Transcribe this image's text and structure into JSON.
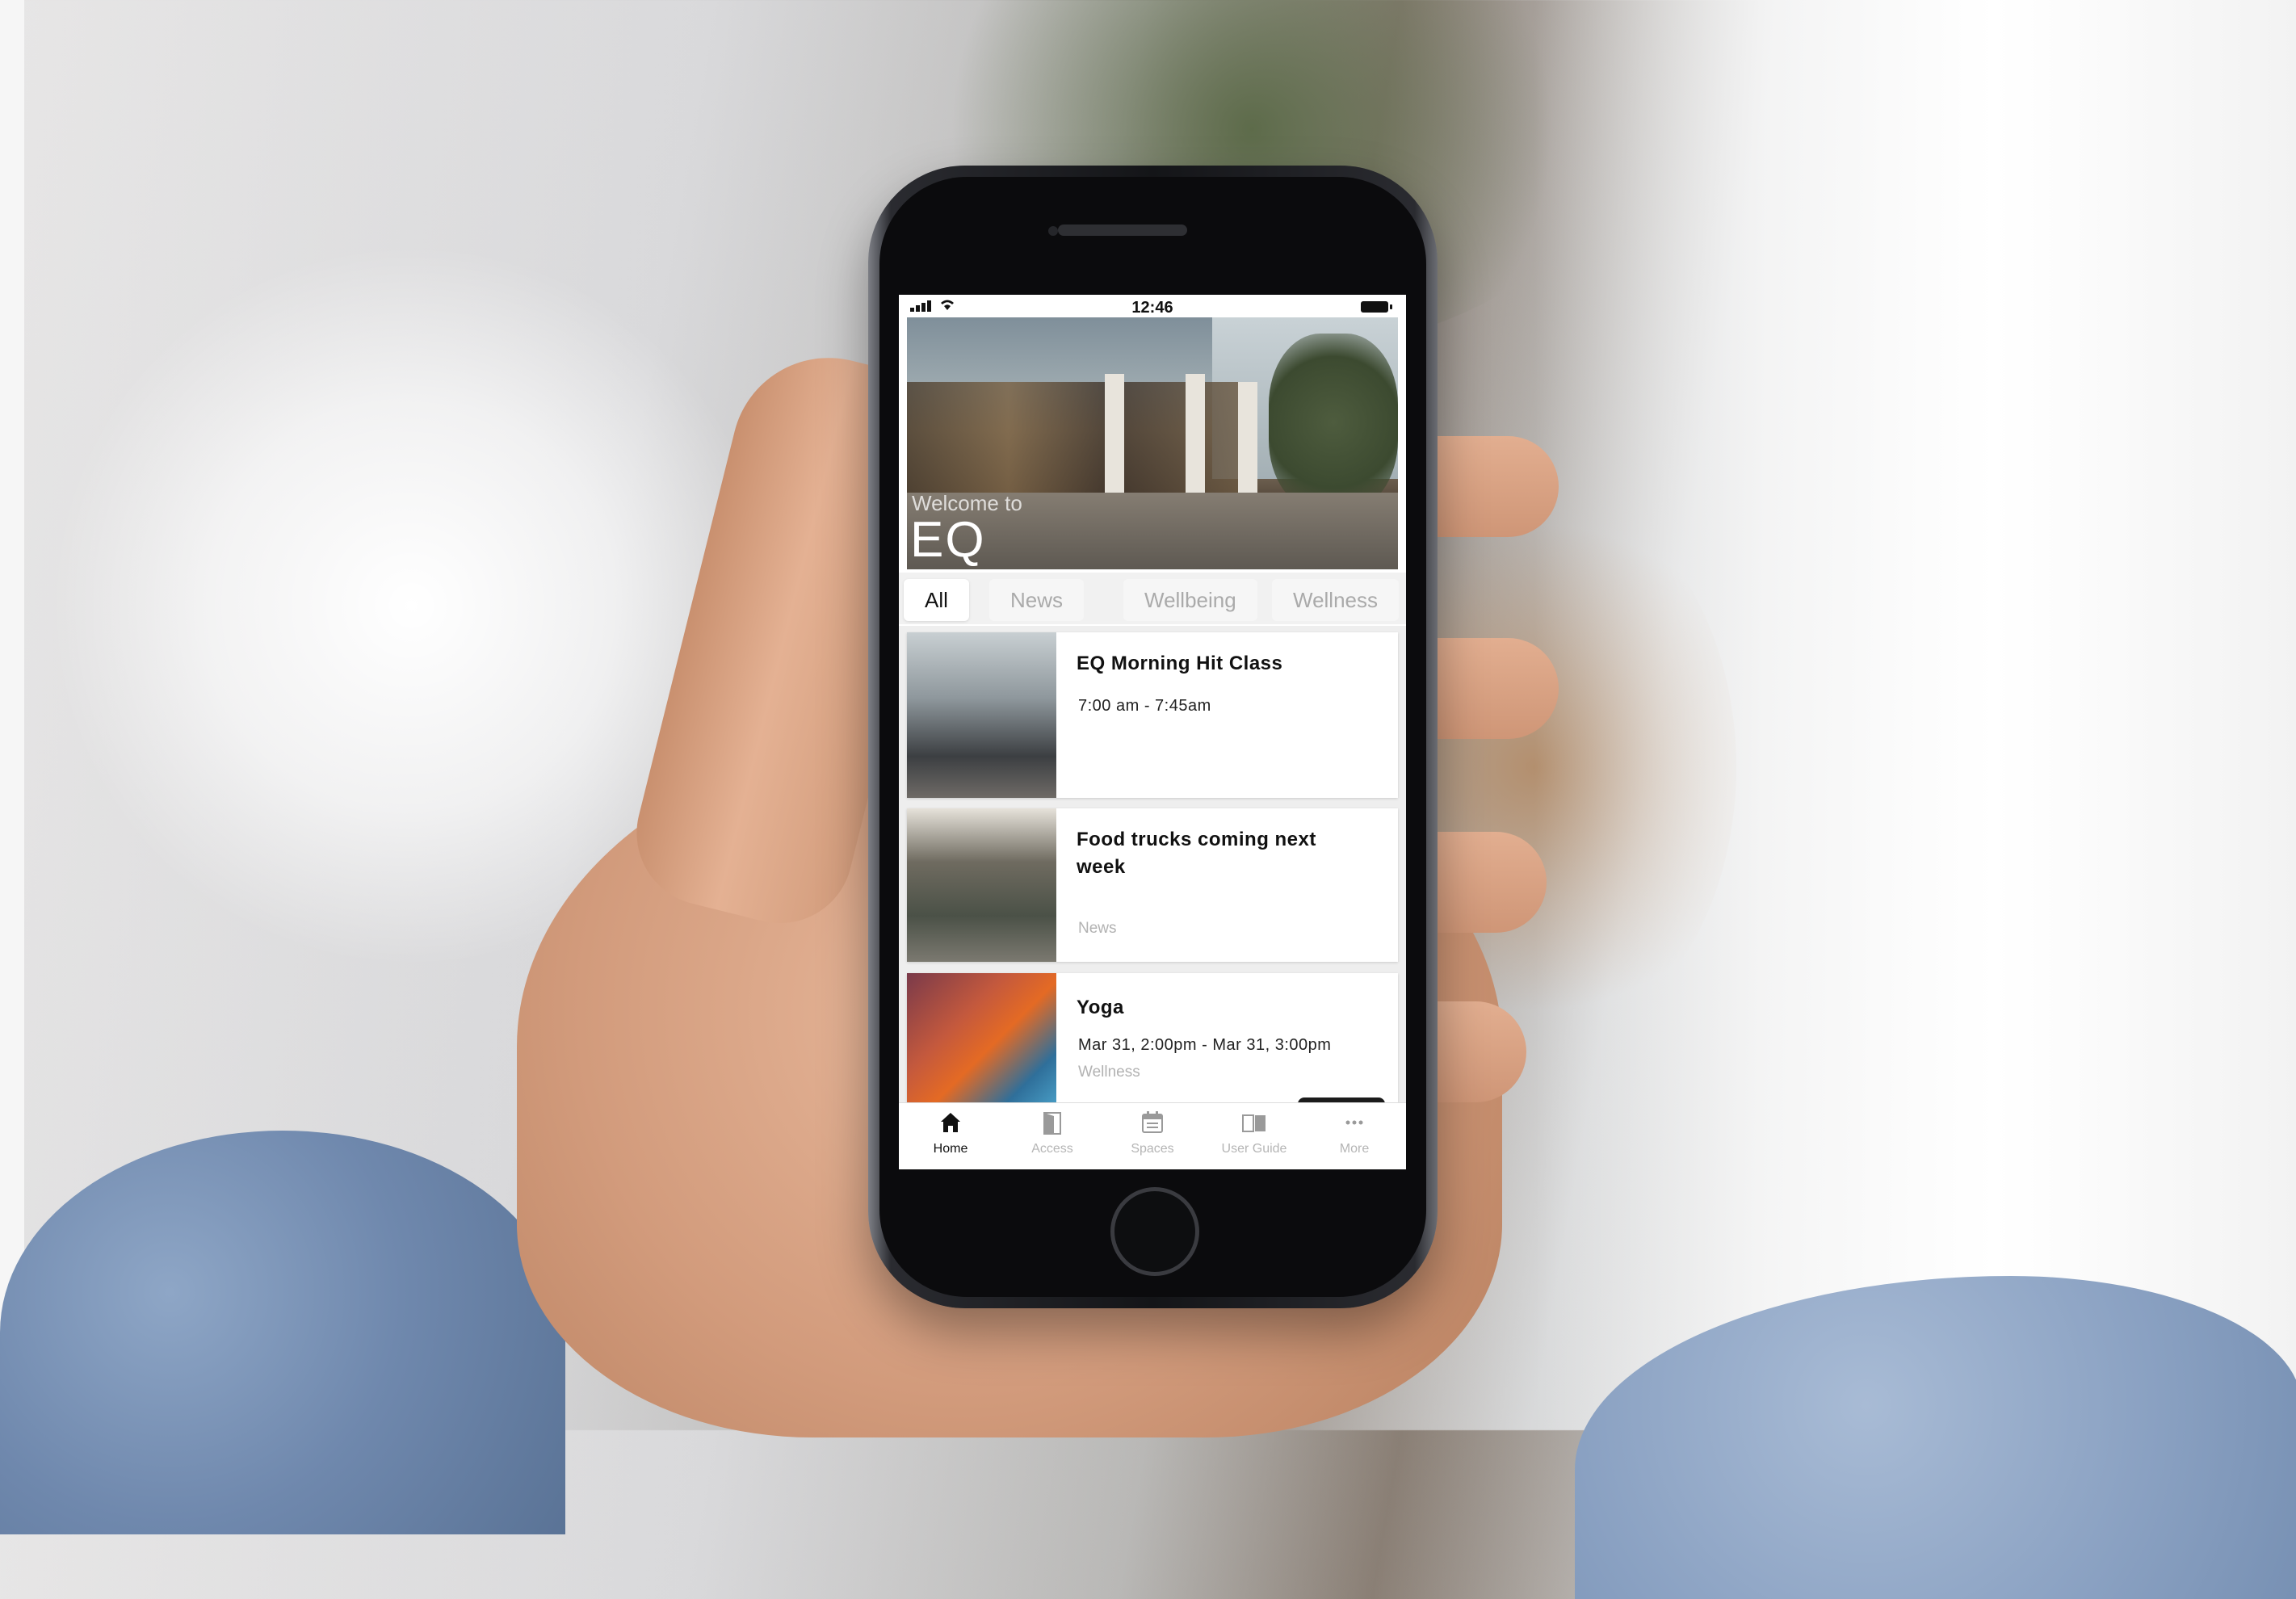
{
  "status_bar": {
    "time": "12:46"
  },
  "hero": {
    "welcome": "Welcome to",
    "title": "EQ"
  },
  "tabs": [
    {
      "label": "All",
      "active": true
    },
    {
      "label": "News",
      "active": false
    },
    {
      "label": "Wellbeing",
      "active": false
    },
    {
      "label": "Wellness",
      "active": false
    }
  ],
  "feed": [
    {
      "title": "EQ Morning Hit Class",
      "subtitle": "7:00 am - 7:45am",
      "category": ""
    },
    {
      "title": "Food trucks coming next week",
      "subtitle": "",
      "category": "News"
    },
    {
      "title": "Yoga",
      "subtitle": "Mar 31, 2:00pm - Mar 31, 3:00pm",
      "category": "Wellness"
    }
  ],
  "nav": [
    {
      "label": "Home",
      "icon": "home-icon",
      "active": true
    },
    {
      "label": "Access",
      "icon": "access-icon",
      "active": false
    },
    {
      "label": "Spaces",
      "icon": "calendar-icon",
      "active": false
    },
    {
      "label": "User Guide",
      "icon": "book-icon",
      "active": false
    },
    {
      "label": "More",
      "icon": "more-icon",
      "active": false
    }
  ],
  "colors": {
    "active_text": "#111111",
    "inactive_text": "#aaaaaa",
    "screen_bg": "#ffffff"
  }
}
